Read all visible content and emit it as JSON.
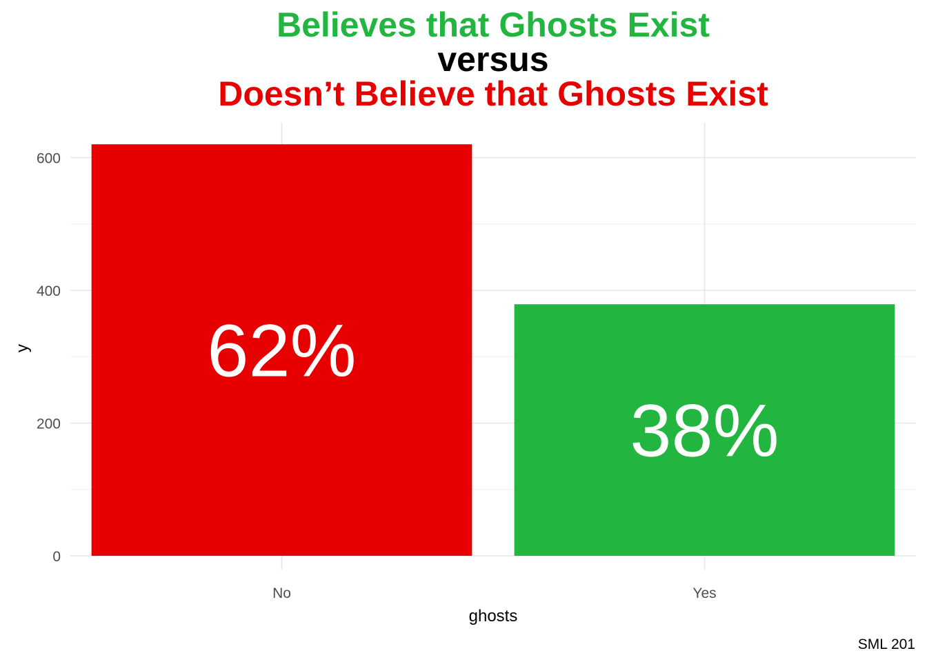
{
  "chart_data": {
    "type": "bar",
    "title_lines": [
      {
        "text": "Believes that Ghosts Exist",
        "color": "#22b53f"
      },
      {
        "text": "versus",
        "color": "#000000"
      },
      {
        "text": "Doesn’t Believe that Ghosts Exist",
        "color": "#e60000"
      }
    ],
    "categories": [
      "No",
      "Yes"
    ],
    "values": [
      620,
      379
    ],
    "bar_labels": [
      "62%",
      "38%"
    ],
    "bar_colors": [
      "#e60000",
      "#22b53f"
    ],
    "xlabel": "ghosts",
    "ylabel": "y",
    "ylim": [
      0,
      650
    ],
    "yticks": [
      0,
      200,
      400,
      600
    ],
    "grid": true,
    "caption": "SML 201"
  }
}
